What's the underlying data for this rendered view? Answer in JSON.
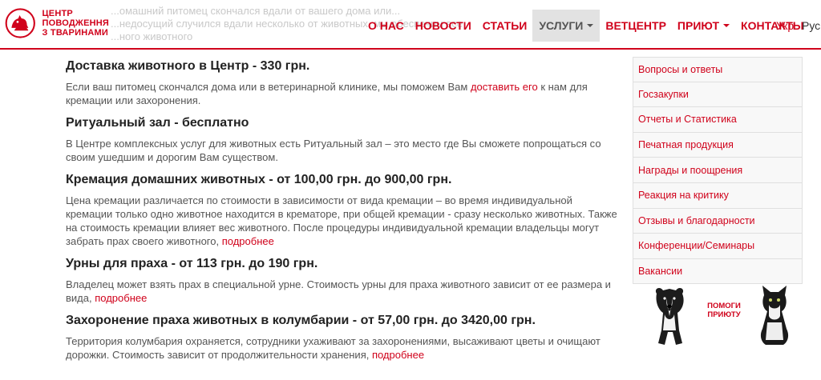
{
  "header": {
    "ghost_lines": [
      "...омашний питомец скончался вдали от вашего дома или...",
      "...недосущий случился вдали несколько от животных, мы обеспечим все",
      "...ного животного"
    ],
    "logo": {
      "line1": "ЦЕНТР",
      "line2": "ПОВОДЖЕННЯ",
      "line3": "З ТВАРИНАМИ"
    },
    "nav": [
      {
        "label": "О НАС"
      },
      {
        "label": "НОВОСТИ"
      },
      {
        "label": "СТАТЬИ"
      },
      {
        "label": "УСЛУГИ",
        "active": true
      },
      {
        "label": "ВЕТЦЕНТР"
      },
      {
        "label": "ПРИЮТ"
      },
      {
        "label": "КОНТАКТЫ"
      }
    ],
    "lang_ukr": "Укр",
    "lang_rus": "Рус"
  },
  "main": {
    "s1": {
      "title": "Доставка животного в Центр - 330 грн.",
      "text_before": "Если ваш питомец скончался дома или в ветеринарной клинике, мы поможем Вам ",
      "link": "доставить его",
      "text_after": " к нам для кремации или захоронения."
    },
    "s2": {
      "title": "Ритуальный зал - бесплатно",
      "text": "В Центре комплексных услуг для животных есть Ритуальный зал – это место где Вы сможете попрощаться со своим ушедшим и дорогим Вам существом."
    },
    "s3": {
      "title": "Кремация домашних животных - от 100,00 грн. до 900,00 грн.",
      "text": "Цена кремации различается по стоимости в зависимости от вида кремации – во время индивидуальной кремации только одно животное находится в крематоре, при общей кремации - сразу несколько животных. Также на стоимость кремации влияет вес животного. После процедуры индивидуальной кремации владельцы могут забрать прах своего животного, ",
      "link": "подробнее"
    },
    "s4": {
      "title": "Урны для праха - от 113 грн. до 190 грн.",
      "text": "Владелец может взять прах в специальной урне. Стоимость урны для праха животного зависит от ее размера и вида, ",
      "link": "подробнее"
    },
    "s5": {
      "title": "Захоронение праха животных в колумбарии - от 57,00 грн. до 3420,00 грн.",
      "text": "Территория колумбария охраняется, сотрудники ухаживают за захоронениями, высаживают цветы и очищают дорожки. Стоимость зависит от продолжительности хранения, ",
      "link": "подробнее"
    }
  },
  "sidebar": {
    "items": [
      {
        "label": "Вопросы и ответы"
      },
      {
        "label": "Госзакупки"
      },
      {
        "label": "Отчеты и Статистика"
      },
      {
        "label": "Печатная продукция"
      },
      {
        "label": "Награды и поощрения"
      },
      {
        "label": "Реакция на критику"
      },
      {
        "label": "Отзывы и благодарности"
      },
      {
        "label": "Конференции/Семинары"
      },
      {
        "label": "Вакансии"
      }
    ],
    "banner": {
      "line1": "ПОМОГИ",
      "line2": "ПРИЮТУ"
    }
  },
  "colors": {
    "accent": "#d0021b",
    "text": "#555555",
    "heading": "#222222",
    "nav_active_bg": "#e2e2e2"
  }
}
